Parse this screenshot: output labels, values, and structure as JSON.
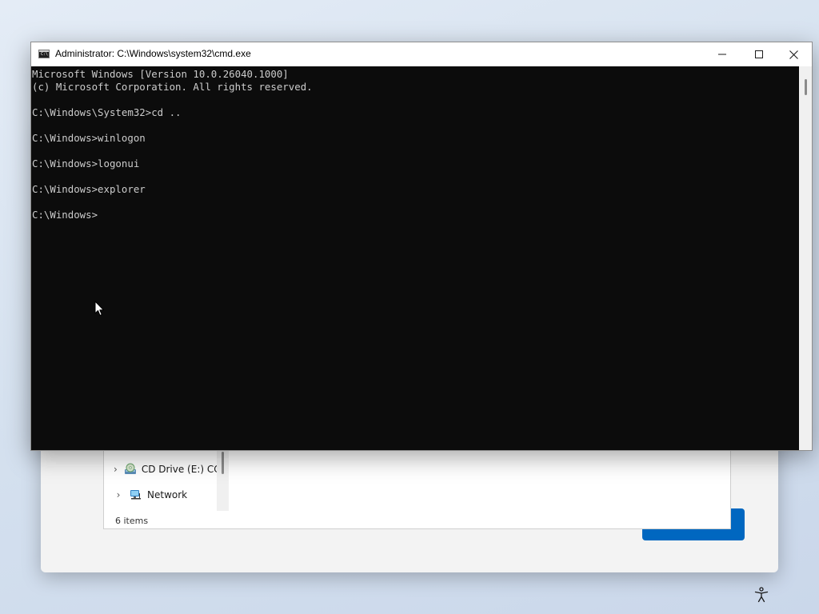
{
  "cmd": {
    "title": "Administrator: C:\\Windows\\system32\\cmd.exe",
    "icon_glyph": "C:\\",
    "console_lines": [
      "Microsoft Windows [Version 10.0.26040.1000]",
      "(c) Microsoft Corporation. All rights reserved.",
      "",
      "C:\\Windows\\System32>cd ..",
      "",
      "C:\\Windows>winlogon",
      "",
      "C:\\Windows>logonui",
      "",
      "C:\\Windows>explorer",
      "",
      "C:\\Windows>"
    ],
    "caption_buttons": [
      "minimize-icon",
      "maximize-icon",
      "close-icon"
    ]
  },
  "explorer": {
    "nav_items": [
      {
        "label": "CD Drive (E:) CC",
        "icon": "cd-drive-icon"
      },
      {
        "label": "Network",
        "icon": "network-icon"
      }
    ],
    "status": "6 items"
  },
  "setup": {
    "primary_button_label": ""
  },
  "colors": {
    "console_bg": "#0c0c0c",
    "console_fg": "#cccccc",
    "accent": "#0067c0"
  },
  "icons": {
    "accessibility": "accessibility-icon",
    "cursor": "mouse-pointer-icon"
  }
}
